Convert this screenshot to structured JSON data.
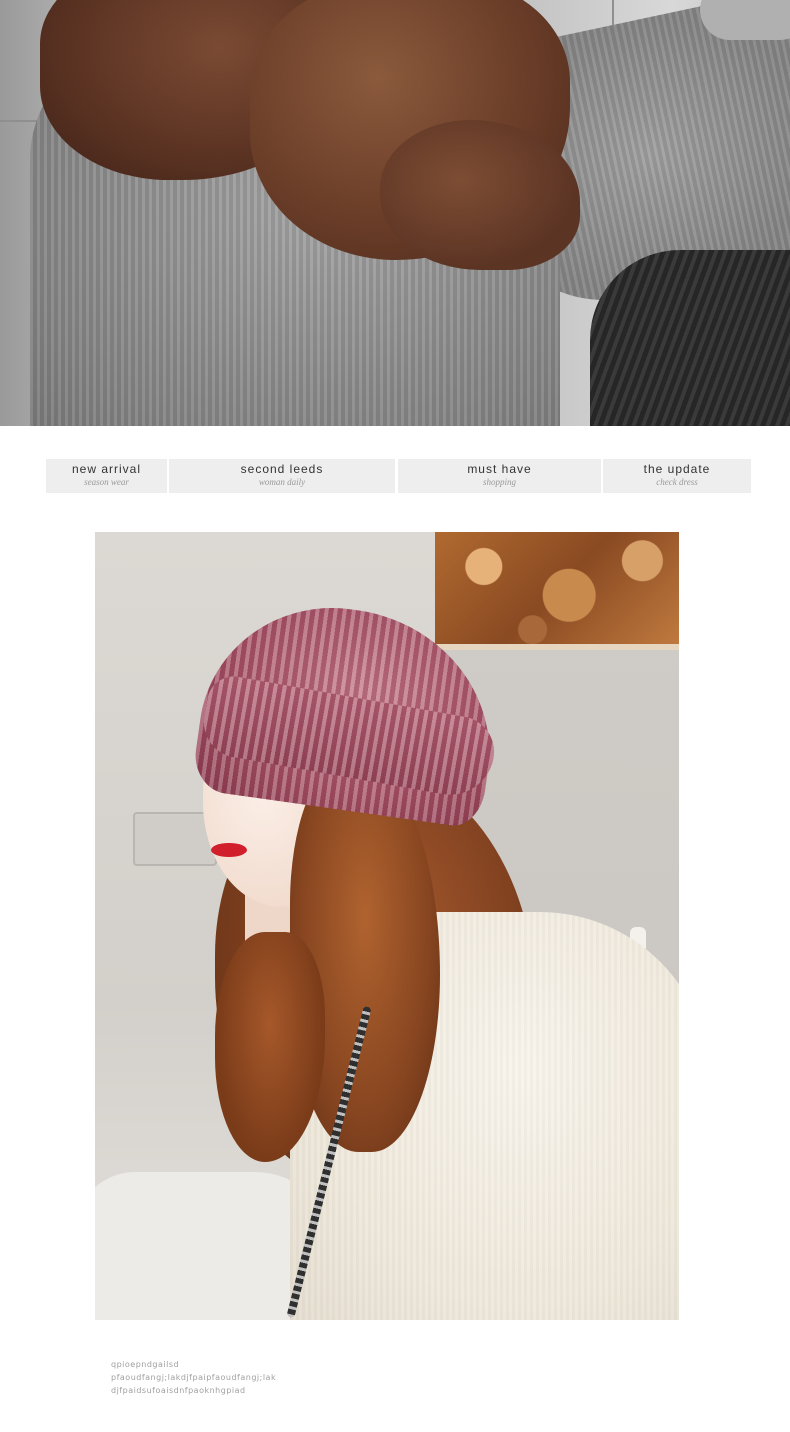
{
  "tabs": [
    {
      "title": "new arrival",
      "subtitle": "season wear"
    },
    {
      "title": "second leeds",
      "subtitle": "woman daily"
    },
    {
      "title": "must have",
      "subtitle": "shopping"
    },
    {
      "title": "the update",
      "subtitle": "check dress"
    }
  ],
  "caption": {
    "lines": [
      "qpioepndgailsd",
      "pfaoudfangj;lakdjfpaipfaoudfangj;lak",
      "djfpaidsufoaisdnfpaoknhgpiad"
    ]
  },
  "colors": {
    "tab_background": "#eeeeee",
    "tab_title": "#333333",
    "tab_subtitle": "#9a9a9a",
    "hat": "#a85468",
    "lips": "#d1202b"
  }
}
